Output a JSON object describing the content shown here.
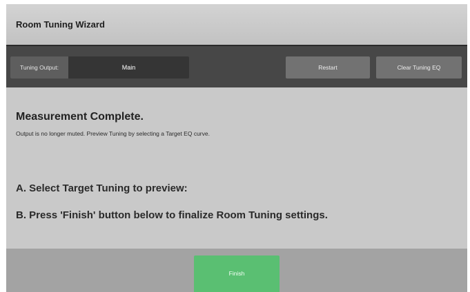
{
  "window": {
    "title": "Room Tuning Wizard"
  },
  "toolbar": {
    "output_label": "Tuning Output:",
    "output_value": "Main",
    "restart_label": "Restart",
    "clear_eq_label": "Clear Tuning EQ"
  },
  "content": {
    "heading": "Measurement Complete.",
    "subtext": "Output is no longer muted. Preview Tuning by selecting a Target EQ curve.",
    "step_a": "A. Select Target Tuning to preview:",
    "step_b": "B. Press 'Finish' button below to finalize Room Tuning settings."
  },
  "footer": {
    "finish_label": "Finish"
  },
  "colors": {
    "finish_accent": "#5abf72",
    "toolbar_bg": "#474747",
    "content_bg": "#c9c9c9"
  }
}
